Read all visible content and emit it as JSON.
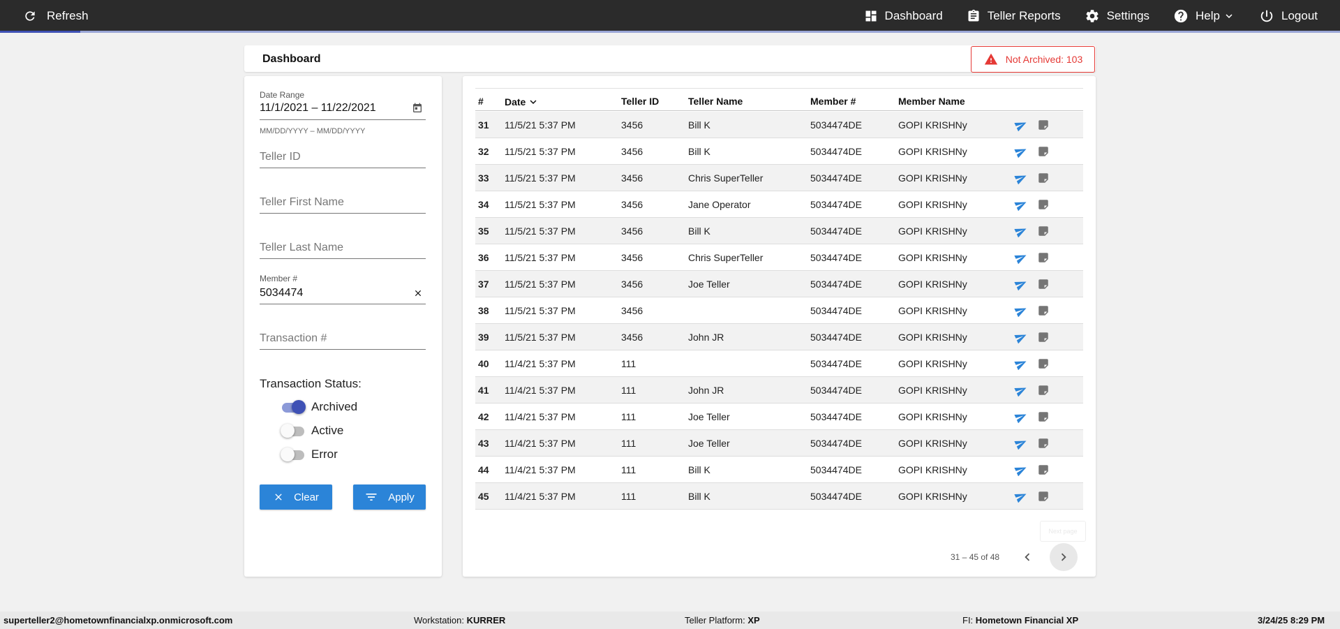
{
  "topbar": {
    "refresh_label": "Refresh",
    "nav": [
      {
        "label": "Dashboard",
        "icon": "dashboard-icon"
      },
      {
        "label": "Teller Reports",
        "icon": "clipboard-icon"
      },
      {
        "label": "Settings",
        "icon": "gear-icon"
      },
      {
        "label": "Help",
        "icon": "help-icon"
      },
      {
        "label": "Logout",
        "icon": "power-icon"
      }
    ]
  },
  "header": {
    "title": "Dashboard",
    "alert": "Not Archived: 103"
  },
  "filters": {
    "date_range_label": "Date Range",
    "date_range_value": "11/1/2021 – 11/22/2021",
    "date_hint": "MM/DD/YYYY – MM/DD/YYYY",
    "teller_id_placeholder": "Teller ID",
    "teller_first_placeholder": "Teller First Name",
    "teller_last_placeholder": "Teller Last Name",
    "member_label": "Member #",
    "member_value": "5034474",
    "transaction_placeholder": "Transaction #",
    "status_title": "Transaction Status:",
    "statuses": [
      {
        "label": "Archived",
        "on": true
      },
      {
        "label": "Active",
        "on": false
      },
      {
        "label": "Error",
        "on": false
      }
    ],
    "clear_label": "Clear",
    "apply_label": "Apply"
  },
  "table": {
    "columns": [
      "#",
      "Date",
      "Teller ID",
      "Teller Name",
      "Member #",
      "Member Name"
    ],
    "rows": [
      {
        "num": "31",
        "date": "11/5/21 5:37 PM",
        "teller_id": "3456",
        "teller_name": "Bill K",
        "member": "5034474DE",
        "member_name": "GOPI KRISHNy"
      },
      {
        "num": "32",
        "date": "11/5/21 5:37 PM",
        "teller_id": "3456",
        "teller_name": "Bill K",
        "member": "5034474DE",
        "member_name": "GOPI KRISHNy"
      },
      {
        "num": "33",
        "date": "11/5/21 5:37 PM",
        "teller_id": "3456",
        "teller_name": "Chris SuperTeller",
        "member": "5034474DE",
        "member_name": "GOPI KRISHNy"
      },
      {
        "num": "34",
        "date": "11/5/21 5:37 PM",
        "teller_id": "3456",
        "teller_name": "Jane Operator",
        "member": "5034474DE",
        "member_name": "GOPI KRISHNy"
      },
      {
        "num": "35",
        "date": "11/5/21 5:37 PM",
        "teller_id": "3456",
        "teller_name": "Bill K",
        "member": "5034474DE",
        "member_name": "GOPI KRISHNy"
      },
      {
        "num": "36",
        "date": "11/5/21 5:37 PM",
        "teller_id": "3456",
        "teller_name": "Chris SuperTeller",
        "member": "5034474DE",
        "member_name": "GOPI KRISHNy"
      },
      {
        "num": "37",
        "date": "11/5/21 5:37 PM",
        "teller_id": "3456",
        "teller_name": "Joe Teller",
        "member": "5034474DE",
        "member_name": "GOPI KRISHNy"
      },
      {
        "num": "38",
        "date": "11/5/21 5:37 PM",
        "teller_id": "3456",
        "teller_name": "",
        "member": "5034474DE",
        "member_name": "GOPI KRISHNy"
      },
      {
        "num": "39",
        "date": "11/5/21 5:37 PM",
        "teller_id": "3456",
        "teller_name": "John JR",
        "member": "5034474DE",
        "member_name": "GOPI KRISHNy"
      },
      {
        "num": "40",
        "date": "11/4/21 5:37 PM",
        "teller_id": "111",
        "teller_name": "",
        "member": "5034474DE",
        "member_name": "GOPI KRISHNy"
      },
      {
        "num": "41",
        "date": "11/4/21 5:37 PM",
        "teller_id": "111",
        "teller_name": "John JR",
        "member": "5034474DE",
        "member_name": "GOPI KRISHNy"
      },
      {
        "num": "42",
        "date": "11/4/21 5:37 PM",
        "teller_id": "111",
        "teller_name": "Joe Teller",
        "member": "5034474DE",
        "member_name": "GOPI KRISHNy"
      },
      {
        "num": "43",
        "date": "11/4/21 5:37 PM",
        "teller_id": "111",
        "teller_name": "Joe Teller",
        "member": "5034474DE",
        "member_name": "GOPI KRISHNy"
      },
      {
        "num": "44",
        "date": "11/4/21 5:37 PM",
        "teller_id": "111",
        "teller_name": "Bill K",
        "member": "5034474DE",
        "member_name": "GOPI KRISHNy"
      },
      {
        "num": "45",
        "date": "11/4/21 5:37 PM",
        "teller_id": "111",
        "teller_name": "Bill K",
        "member": "5034474DE",
        "member_name": "GOPI KRISHNy"
      }
    ],
    "pagination": "31 – 45 of 48",
    "ghost_button": "Next page"
  },
  "footer": {
    "user": "superteller2@hometownfinancialxp.onmicrosoft.com",
    "workstation_label": "Workstation:",
    "workstation_value": "KURRER",
    "platform_label": "Teller Platform:",
    "platform_value": "XP",
    "fi_label": "FI:",
    "fi_value": "Hometown Financial XP",
    "datetime": "3/24/25 8:29 PM"
  },
  "colors": {
    "topbar": "#2b2b2b",
    "accent": "#2b84d8",
    "alert": "#e53935",
    "toggle_on": "#3f51b5",
    "send_icon": "#2b84d8",
    "note_icon": "#757575"
  },
  "loading_progress": 0.06
}
